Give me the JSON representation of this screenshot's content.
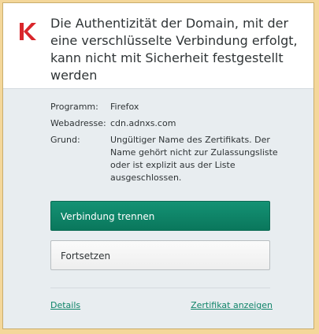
{
  "dialog": {
    "title": "Die Authentizität der Domain, mit der eine verschlüsselte Verbindung erfolgt, kann nicht mit Sicherheit festgestellt werden"
  },
  "details": {
    "program_label": "Programm:",
    "program_value": "Firefox",
    "address_label": "Webadresse:",
    "address_value": "cdn.adnxs.com",
    "reason_label": "Grund:",
    "reason_value": "Ungültiger Name des Zertifikats. Der Name gehört nicht zur Zulassungsliste oder ist explizit aus der Liste ausgeschlossen."
  },
  "buttons": {
    "disconnect": "Verbindung trennen",
    "continue": "Fortsetzen"
  },
  "links": {
    "details": "Details",
    "view_certificate": "Zertifikat anzeigen"
  },
  "colors": {
    "accent": "#0f8469",
    "logo": "#d9262b"
  },
  "icons": {
    "logo": "kaspersky-k-icon"
  }
}
